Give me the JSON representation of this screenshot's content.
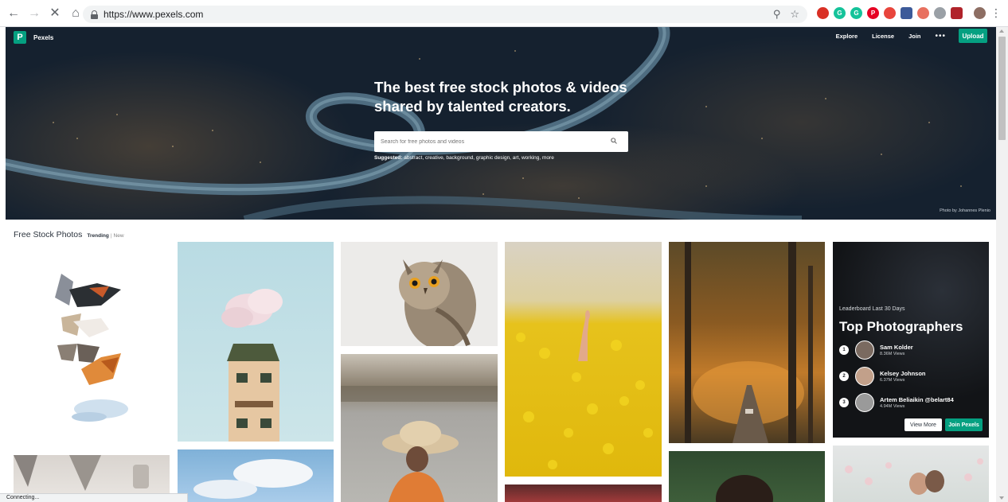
{
  "browser": {
    "url": "https://www.pexels.com",
    "status": "Connecting..."
  },
  "header": {
    "logo_letter": "P",
    "brand": "Pexels",
    "nav": [
      "Explore",
      "License",
      "Join"
    ],
    "more": "•••",
    "upload_label": "Upload"
  },
  "hero": {
    "title": "The best free stock photos & videos shared by talented creators.",
    "search_placeholder": "Search for free photos and videos",
    "suggested_label": "Suggested:",
    "suggested_terms": "abstract, creative, background, graphic design, art, working, more",
    "credit": "Photo by Johannes Plenio"
  },
  "feed": {
    "title": "Free Stock Photos",
    "tab_active": "Trending",
    "separator": "|",
    "tab_other": "New"
  },
  "leaderboard": {
    "subtitle": "Leaderboard Last 30 Days",
    "title": "Top Photographers",
    "photographers": [
      {
        "rank": "1",
        "name": "Sam Kolder",
        "views": "8.36M Views"
      },
      {
        "rank": "2",
        "name": "Kelsey Johnson",
        "views": "6.37M Views"
      },
      {
        "rank": "3",
        "name": "Artem Beliaikin @belart84",
        "views": "4.94M Views"
      }
    ],
    "view_more": "View More",
    "join": "Join Pexels"
  },
  "colors": {
    "accent": "#05a081",
    "text": "#2c343e"
  }
}
